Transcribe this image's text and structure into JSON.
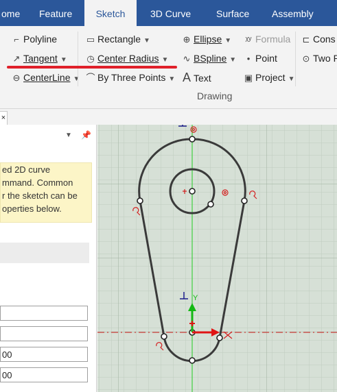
{
  "tabs": [
    {
      "label": "ome",
      "active": false
    },
    {
      "label": "Feature",
      "active": false
    },
    {
      "label": "Sketch",
      "active": true
    },
    {
      "label": "3D Curve",
      "active": false
    },
    {
      "label": "Surface",
      "active": false
    },
    {
      "label": "Assembly",
      "active": false
    }
  ],
  "ribbon": {
    "polyline": "Polyline",
    "tangent": "Tangent",
    "centerline": "CenterLine",
    "rectangle": "Rectangle",
    "center_radius": "Center Radius",
    "three_points": "By Three Points",
    "ellipse": "Ellipse",
    "formula": "Formula",
    "bspline": "BSpline",
    "point": "Point",
    "text": "Text",
    "project": "Project",
    "constraint": "Cons",
    "two_point": "Two P",
    "group_label": "Drawing"
  },
  "panel": {
    "info_lines": [
      "ed 2D curve",
      "mmand. Common",
      "r the sketch can be",
      "operties below."
    ],
    "fields": [
      "",
      "",
      "00",
      "00"
    ]
  },
  "colors": {
    "accent": "#2b579a",
    "highlight": "#e0202a",
    "sketch_axis": "#00c800",
    "info_bg": "#fcf5c7",
    "canvas_bg": "#d6e0d6"
  }
}
